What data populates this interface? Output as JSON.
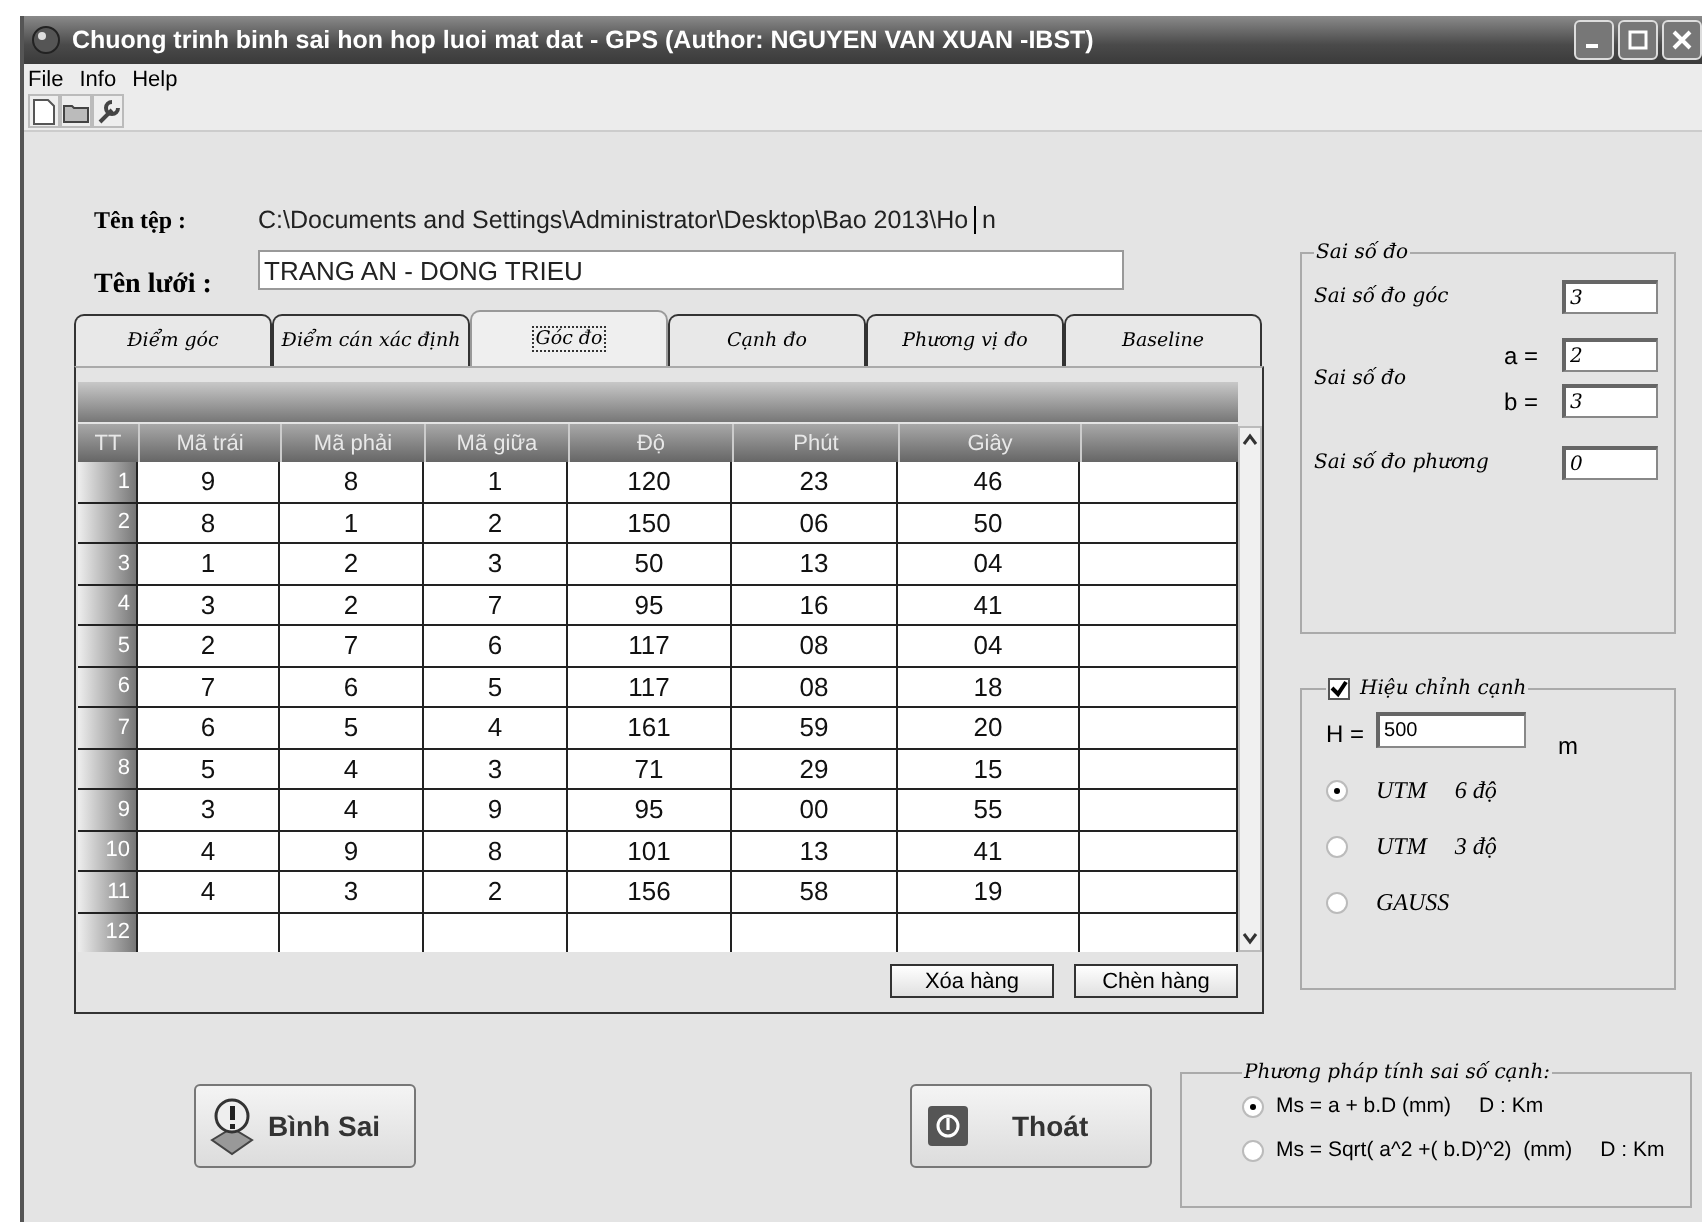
{
  "window": {
    "title": "Chuong trinh binh sai hon hop luoi mat dat - GPS (Author: NGUYEN VAN XUAN -IBST)"
  },
  "menu": [
    "File",
    "Info",
    "Help"
  ],
  "file": {
    "label": "Tên tệp :",
    "path": "C:\\Documents and Settings\\Administrator\\Desktop\\Bao 2013\\Ho",
    "cursor_tail": "n"
  },
  "network": {
    "label": "Tên lưới :",
    "value": "TRANG AN - DONG TRIEU"
  },
  "tabs": [
    {
      "label": "Điểm góc",
      "selected": false
    },
    {
      "label": "Điểm cán xác định",
      "selected": false
    },
    {
      "label": "Góc đo",
      "selected": true
    },
    {
      "label": "Cạnh đo",
      "selected": false
    },
    {
      "label": "Phương vị đo",
      "selected": false
    },
    {
      "label": "Baseline",
      "selected": false
    }
  ],
  "table": {
    "columns": [
      "TT",
      "Mã trái",
      "Mã phải",
      "Mã giữa",
      "Độ",
      "Phút",
      "Giây"
    ],
    "rows": [
      [
        "1",
        "9",
        "8",
        "1",
        "120",
        "23",
        "46"
      ],
      [
        "2",
        "8",
        "1",
        "2",
        "150",
        "06",
        "50"
      ],
      [
        "3",
        "1",
        "2",
        "3",
        "50",
        "13",
        "04"
      ],
      [
        "4",
        "3",
        "2",
        "7",
        "95",
        "16",
        "41"
      ],
      [
        "5",
        "2",
        "7",
        "6",
        "117",
        "08",
        "04"
      ],
      [
        "6",
        "7",
        "6",
        "5",
        "117",
        "08",
        "18"
      ],
      [
        "7",
        "6",
        "5",
        "4",
        "161",
        "59",
        "20"
      ],
      [
        "8",
        "5",
        "4",
        "3",
        "71",
        "29",
        "15"
      ],
      [
        "9",
        "3",
        "4",
        "9",
        "95",
        "00",
        "55"
      ],
      [
        "10",
        "4",
        "9",
        "8",
        "101",
        "13",
        "41"
      ],
      [
        "11",
        "4",
        "3",
        "2",
        "156",
        "58",
        "19"
      ],
      [
        "12",
        "",
        "",
        "",
        "",
        "",
        ""
      ]
    ]
  },
  "table_buttons": [
    "Xóa hàng",
    "Chèn hàng"
  ],
  "errors": {
    "title": "Sai số đo",
    "angle_label": "Sai số đo góc",
    "angle_value": "3",
    "side_label": "Sai số đo",
    "a_label": "a =",
    "a_value": "2",
    "b_label": "b =",
    "b_value": "3",
    "azimuth_label": "Sai số đo phương",
    "azimuth_value": "0"
  },
  "correction": {
    "label": "Hiệu chỉnh cạnh",
    "checked": true,
    "h_label": "H =",
    "h_value": "500",
    "h_unit": "m",
    "options": [
      {
        "label": "UTM",
        "sub": "6 độ",
        "selected": true
      },
      {
        "label": "UTM",
        "sub": "3 độ",
        "selected": false
      },
      {
        "label": "GAUSS",
        "selected": false
      }
    ]
  },
  "actions": [
    "Bình Sai",
    "Thoát"
  ],
  "method": {
    "title": "Phương pháp tính sai số cạnh:",
    "options": [
      {
        "formula": "Ms = a + b.D (mm)",
        "unit": "D : Km",
        "selected": true
      },
      {
        "formula": "Ms = Sqrt( a^2 +( b.D)^2)  (mm)",
        "unit": "D : Km",
        "selected": false
      }
    ]
  }
}
